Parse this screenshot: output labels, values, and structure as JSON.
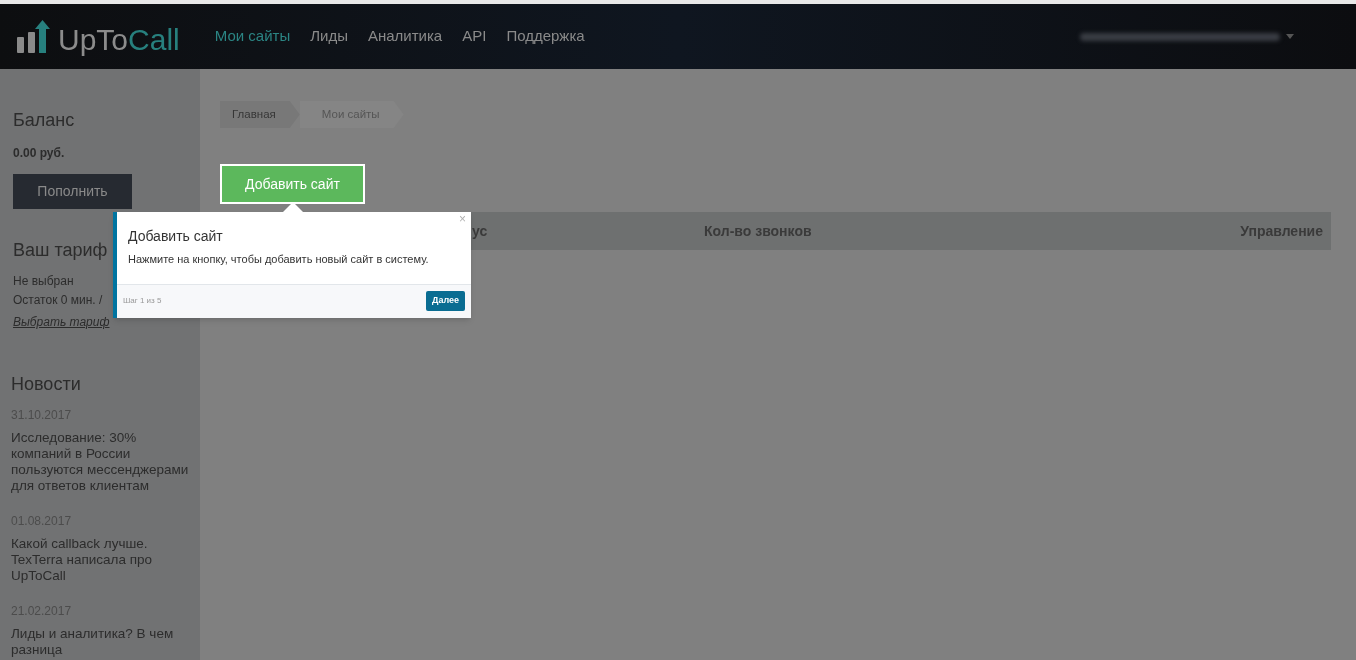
{
  "header": {
    "logo": {
      "part_1": "UpTo",
      "part_2": "Call"
    },
    "nav": [
      {
        "label": "Мои сайты",
        "selected": true
      },
      {
        "label": "Лиды",
        "selected": false
      },
      {
        "label": "Аналитика",
        "selected": false
      },
      {
        "label": "API",
        "selected": false
      },
      {
        "label": "Поддержка",
        "selected": false
      }
    ]
  },
  "sidebar": {
    "balance": {
      "title": "Баланс",
      "amount": "0.00 руб.",
      "button": "Пополнить"
    },
    "tariff": {
      "title": "Ваш тариф",
      "status": "Не выбран",
      "remaining": "Остаток 0 мин. /",
      "link": "Выбрать тариф"
    },
    "news": {
      "title": "Новости",
      "items": [
        {
          "date": "31.10.2017",
          "text": "Исследование: 30% компаний в России пользуются мессенджерами для ответов клиентам"
        },
        {
          "date": "01.08.2017",
          "text": "Какой callback лучше. TexTerra написала про UpToCall"
        },
        {
          "date": "21.02.2017",
          "text": "Лиды и аналитика? В чем разница"
        }
      ]
    }
  },
  "breadcrumbs": [
    {
      "label": "Главная",
      "selected": false
    },
    {
      "label": "Мои сайты",
      "selected": true
    }
  ],
  "add_button": "Добавить сайт",
  "table": {
    "columns": [
      "ус",
      "Кол-во звонков",
      "Управление"
    ]
  },
  "tour_popover": {
    "title": "Добавить сайт",
    "text": "Нажмите на кнопку, чтобы добавить новый сайт в систему.",
    "close": "×",
    "step": "Шаг 1 из 5",
    "next": "Далее"
  }
}
